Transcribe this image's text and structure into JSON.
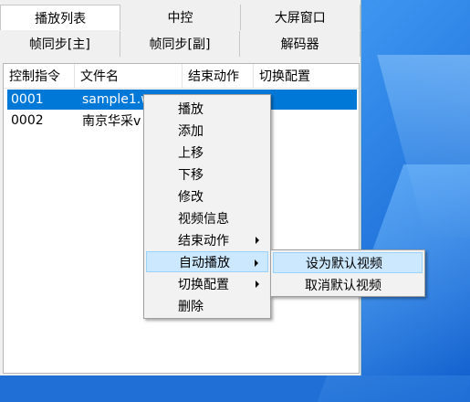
{
  "tabs_row1": [
    "播放列表",
    "中控",
    "大屏窗口"
  ],
  "tabs_row2": [
    "帧同步[主]",
    "帧同步[副]",
    "解码器"
  ],
  "columns": [
    "控制指令",
    "文件名",
    "结束动作",
    "切换配置"
  ],
  "rows": [
    {
      "cmd": "0001",
      "file": "sample1.w",
      "end": "",
      "switch": "",
      "selected": true
    },
    {
      "cmd": "0002",
      "file": "南京华采v",
      "end": "",
      "switch": "",
      "selected": false
    }
  ],
  "context_menu": {
    "items": [
      "播放",
      "添加",
      "上移",
      "下移",
      "修改",
      "视频信息",
      "结束动作",
      "自动播放",
      "切换配置",
      "删除"
    ],
    "highlighted": "自动播放"
  },
  "submenu": {
    "items": [
      "设为默认视频",
      "取消默认视频"
    ],
    "highlighted": "设为默认视频"
  },
  "colors": {
    "selection": "#0078d7",
    "menu_highlight": "#cce8ff",
    "desktop": "#1f6fd6"
  }
}
